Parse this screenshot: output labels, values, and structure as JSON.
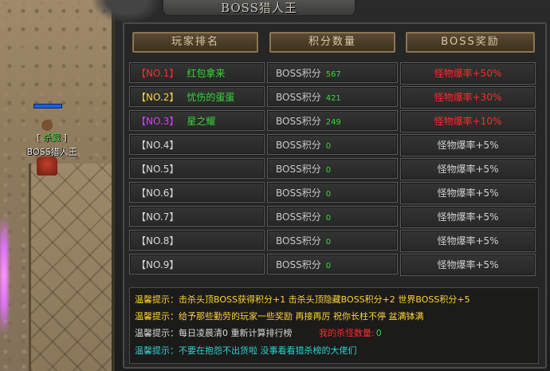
{
  "window": {
    "title": "BOSS猎人王"
  },
  "player": {
    "hp": 1.0,
    "tag_open": "[ ",
    "tag": "杀戮",
    "tag_close": " ]",
    "title": "BOSS猎人王"
  },
  "headers": {
    "rank": "玩家排名",
    "score": "积分数量",
    "reward": "BOSS奖励"
  },
  "rows": [
    {
      "rank": "【NO.1】",
      "name": "红包拿来",
      "score_label": "BOSS积分",
      "score": "567",
      "reward": "怪物爆率+50%",
      "color": "#ff2a2a"
    },
    {
      "rank": "【NO.2】",
      "name": "忧伤的蛋蛋",
      "score_label": "BOSS积分",
      "score": "421",
      "reward": "怪物爆率+30%",
      "color": "#ffd23a"
    },
    {
      "rank": "【NO.3】",
      "name": "星之耀",
      "score_label": "BOSS积分",
      "score": "249",
      "reward": "怪物爆率+10%",
      "color": "#d63cff"
    },
    {
      "rank": "【NO.4】",
      "name": "",
      "score_label": "BOSS积分",
      "score": "0",
      "reward": "怪物爆率+5%",
      "color": "#d8d8d8"
    },
    {
      "rank": "【NO.5】",
      "name": "",
      "score_label": "BOSS积分",
      "score": "0",
      "reward": "怪物爆率+5%",
      "color": "#d8d8d8"
    },
    {
      "rank": "【NO.6】",
      "name": "",
      "score_label": "BOSS积分",
      "score": "0",
      "reward": "怪物爆率+5%",
      "color": "#d8d8d8"
    },
    {
      "rank": "【NO.7】",
      "name": "",
      "score_label": "BOSS积分",
      "score": "0",
      "reward": "怪物爆率+5%",
      "color": "#d8d8d8"
    },
    {
      "rank": "【NO.8】",
      "name": "",
      "score_label": "BOSS积分",
      "score": "0",
      "reward": "怪物爆率+5%",
      "color": "#d8d8d8"
    },
    {
      "rank": "【NO.9】",
      "name": "",
      "score_label": "BOSS积分",
      "score": "0",
      "reward": "怪物爆率+5%",
      "color": "#d8d8d8"
    }
  ],
  "tips": {
    "label": "温馨提示：",
    "line1": "击杀头顶BOSS获得积分+1 击杀头顶隐藏BOSS积分+2 世界BOSS积分+5",
    "line2": "给予那些勤劳的玩家一些奖励 再接再厉 祝你长柱不停 盆满钵满",
    "line3": "每日凌晨清0 重新计算排行榜",
    "kills_label": "我的杀怪数量:",
    "kills_value": "0",
    "line4": "不要在抱怨不出货啦  没事看看猎杀榜的大佬们"
  }
}
